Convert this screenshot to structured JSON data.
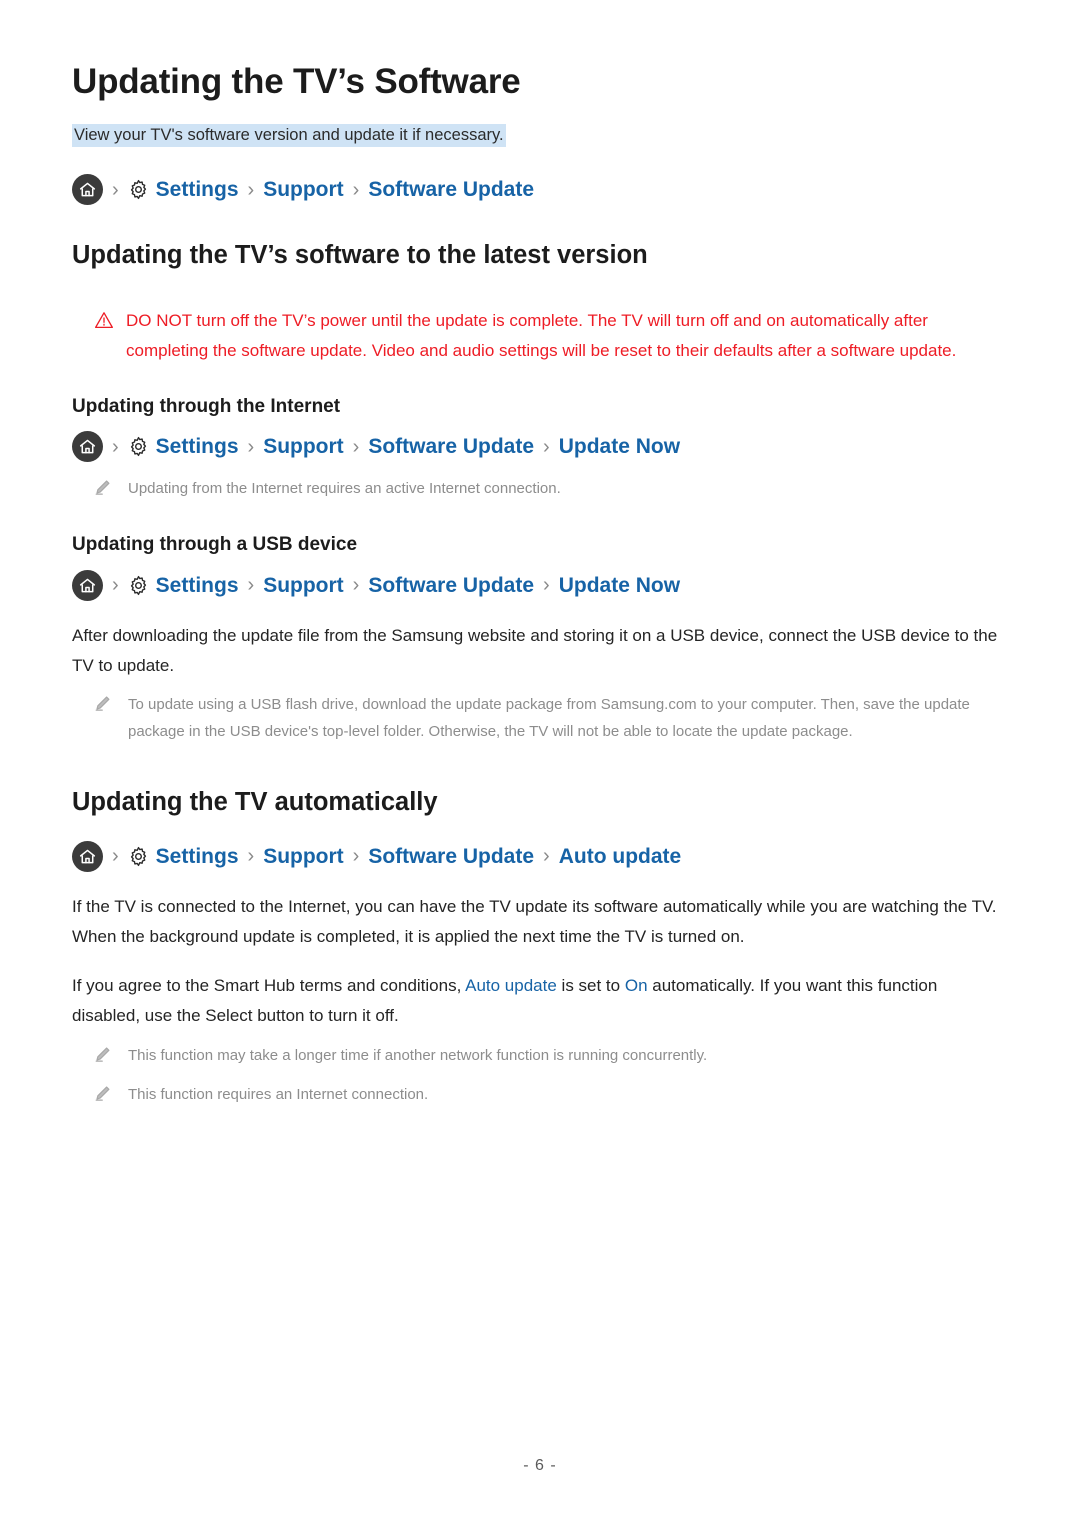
{
  "colors": {
    "link_blue": "#1763a6",
    "warning_red": "#ee1c25",
    "highlight_bg": "#cfe3f5",
    "note_gray": "#8d8d8d",
    "home_circle": "#3b3b3b"
  },
  "page_title": "Updating the TV’s Software",
  "intro_highlight": "View your TV's software version and update it if necessary.",
  "breadcrumb_main": {
    "home_icon": "home-icon",
    "gear_icon": "gear-icon",
    "items": [
      "Settings",
      "Support",
      "Software Update"
    ]
  },
  "section_latest": {
    "heading": "Updating the TV’s software to the latest version",
    "warning_icon": "warning-triangle-icon",
    "warning": "DO NOT turn off the TV’s power until the update is complete. The TV will turn off and on automatically after completing the software update. Video and audio settings will be reset to their defaults after a software update."
  },
  "section_internet": {
    "heading": "Updating through the Internet",
    "breadcrumb": {
      "home_icon": "home-icon",
      "gear_icon": "gear-icon",
      "items": [
        "Settings",
        "Support",
        "Software Update",
        "Update Now"
      ]
    },
    "note": "Updating from the Internet requires an active Internet connection."
  },
  "section_usb": {
    "heading": "Updating through a USB device",
    "breadcrumb": {
      "home_icon": "home-icon",
      "gear_icon": "gear-icon",
      "items": [
        "Settings",
        "Support",
        "Software Update",
        "Update Now"
      ]
    },
    "paragraph": "After downloading the update file from the Samsung website and storing it on a USB device, connect the USB device to the TV to update.",
    "note": "To update using a USB flash drive, download the update package from Samsung.com to your computer. Then, save the update package in the USB device's top-level folder. Otherwise, the TV will not be able to locate the update package."
  },
  "section_auto": {
    "heading": "Updating the TV automatically",
    "breadcrumb": {
      "home_icon": "home-icon",
      "gear_icon": "gear-icon",
      "items": [
        "Settings",
        "Support",
        "Software Update",
        "Auto update"
      ]
    },
    "paragraph1": "If the TV is connected to the Internet, you can have the TV update its software automatically while you are watching the TV. When the background update is completed, it is applied the next time the TV is turned on.",
    "paragraph2_part1": "If you agree to the Smart Hub terms and conditions, ",
    "paragraph2_link1": "Auto update",
    "paragraph2_part2": " is set to ",
    "paragraph2_link2": "On",
    "paragraph2_part3": " automatically. If you want this function disabled, use the Select button to turn it off.",
    "note1": "This function may take a longer time if another network function is running concurrently.",
    "note2": "This function requires an Internet connection."
  },
  "footer": {
    "page_number": "- 6 -"
  }
}
